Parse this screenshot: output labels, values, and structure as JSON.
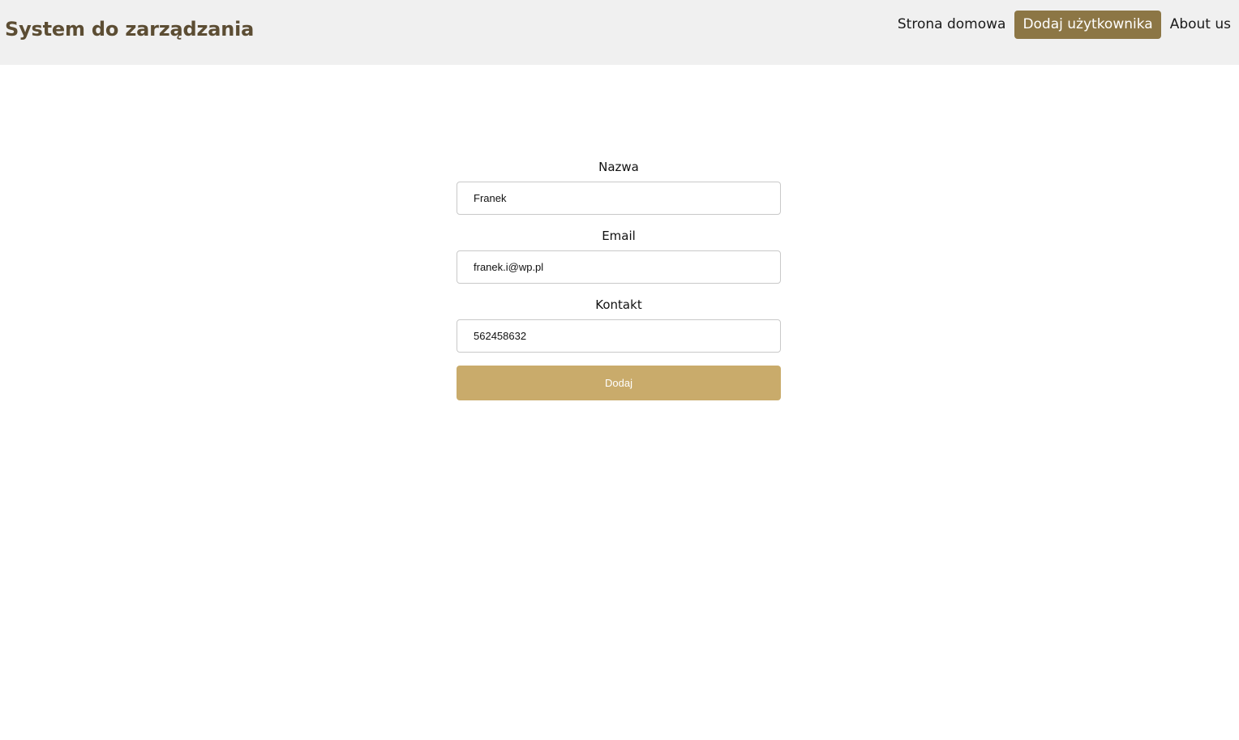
{
  "header": {
    "brand": "System do zarządzania",
    "nav": [
      {
        "label": "Strona domowa",
        "active": false
      },
      {
        "label": "Dodaj użytkownika",
        "active": true
      },
      {
        "label": "About us",
        "active": false
      }
    ]
  },
  "form": {
    "fields": [
      {
        "label": "Nazwa",
        "value": "Franek"
      },
      {
        "label": "Email",
        "value": "franek.i@wp.pl"
      },
      {
        "label": "Kontakt",
        "value": "562458632"
      }
    ],
    "submit_label": "Dodaj"
  },
  "colors": {
    "header_bg": "#f0f0f0",
    "brand": "#5c4d33",
    "nav_active_bg": "#8c7645",
    "submit_bg": "#c9ab6b"
  }
}
